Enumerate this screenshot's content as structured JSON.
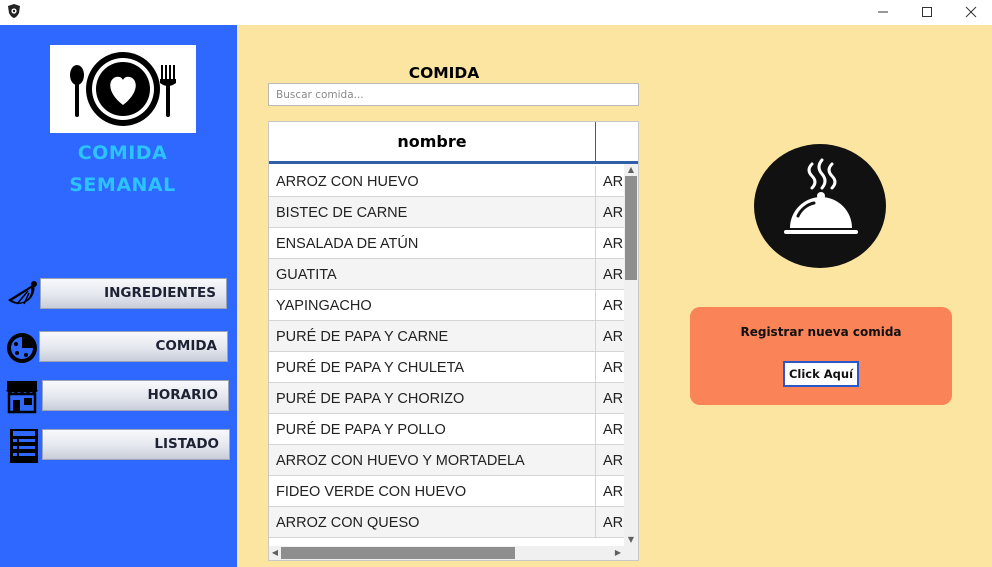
{
  "window": {
    "app_icon": "gear-shield-icon",
    "controls": [
      "minimize-icon",
      "maximize-icon",
      "close-icon"
    ]
  },
  "sidebar": {
    "logo_icon": "plate-heart-cutlery-icon",
    "brand_line1": "COMIDA",
    "brand_line2": "SEMANAL",
    "items": [
      {
        "label": "INGREDIENTES",
        "icon": "lemon-slice-icon"
      },
      {
        "label": "COMIDA",
        "icon": "pizza-icon"
      },
      {
        "label": "HORARIO",
        "icon": "storefront-icon"
      },
      {
        "label": "LISTADO",
        "icon": "menu-list-icon"
      }
    ]
  },
  "main": {
    "title": "COMIDA",
    "search_placeholder": "Buscar comida...",
    "table": {
      "columns": [
        "nombre",
        ""
      ],
      "rows": [
        [
          "ARROZ CON HUEVO",
          "ARI"
        ],
        [
          "BISTEC DE CARNE",
          "ARI"
        ],
        [
          "ENSALADA DE ATÚN",
          "ARI"
        ],
        [
          "GUATITA",
          "ARI"
        ],
        [
          "YAPINGACHO",
          "ARI"
        ],
        [
          "PURÉ DE PAPA Y CARNE",
          "ARI"
        ],
        [
          "PURÉ DE PAPA Y CHULETA",
          "ARI"
        ],
        [
          "PURÉ DE PAPA Y CHORIZO",
          "ARI"
        ],
        [
          "PURÉ DE PAPA Y POLLO",
          "ARI"
        ],
        [
          "ARROZ CON HUEVO Y MORTADELA",
          "ARI"
        ],
        [
          "FIDEO VERDE CON HUEVO",
          "ARI"
        ],
        [
          "ARROZ CON QUESO",
          "ARI"
        ]
      ]
    },
    "dish_icon": "covered-dish-cloche-icon",
    "register_card": {
      "title": "Registrar nueva comida",
      "button": "Click Aquí"
    }
  },
  "colors": {
    "sidebar_bg": "#2e68fe",
    "brand_text": "#2cc4ff",
    "main_bg": "#fbe5a1",
    "card_bg": "#fa8358",
    "button_border": "#2a57c9"
  }
}
